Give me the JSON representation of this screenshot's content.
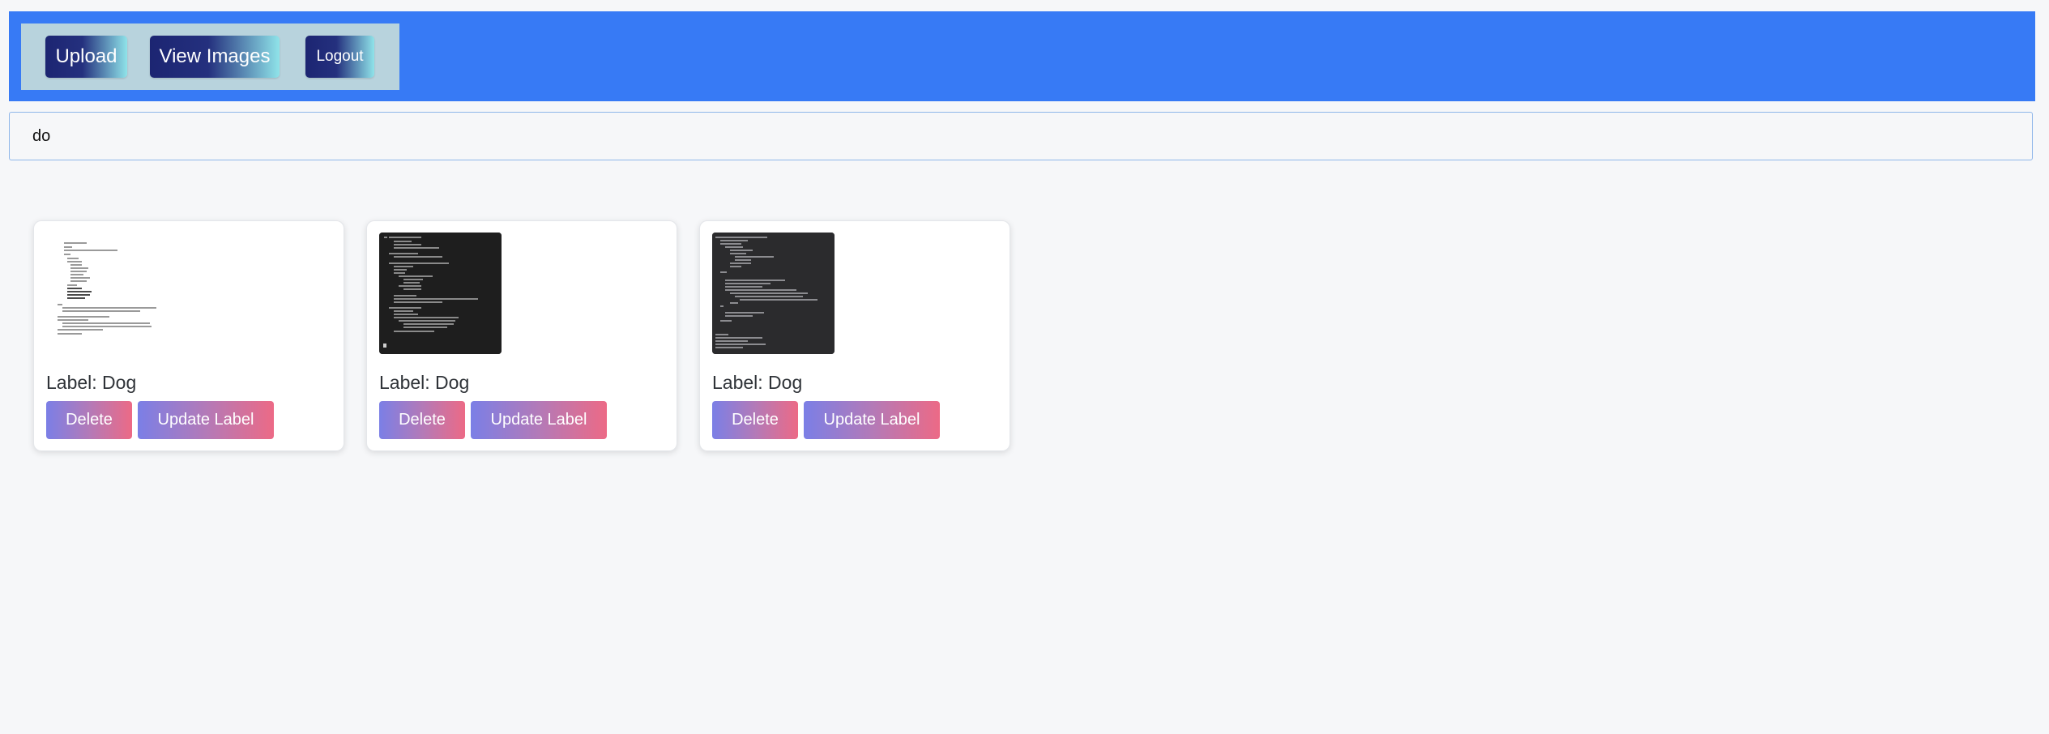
{
  "nav": {
    "upload_label": "Upload",
    "view_images_label": "View Images",
    "logout_label": "Logout"
  },
  "search": {
    "value": "do",
    "placeholder": ""
  },
  "cards": [
    {
      "label_text": "Label: Dog",
      "delete_label": "Delete",
      "update_label": "Update Label",
      "thumbnail": "light-code-screenshot"
    },
    {
      "label_text": "Label: Dog",
      "delete_label": "Delete",
      "update_label": "Update Label",
      "thumbnail": "dark-code-screenshot"
    },
    {
      "label_text": "Label: Dog",
      "delete_label": "Delete",
      "update_label": "Update Label",
      "thumbnail": "dark-code-screenshot"
    }
  ],
  "colors": {
    "topbar": "#377af5",
    "nav_box": "#b8d3dd",
    "page_bg": "#f6f7f9",
    "button_gradient_start": "#7b7fe6",
    "button_gradient_end": "#ec6a86"
  }
}
